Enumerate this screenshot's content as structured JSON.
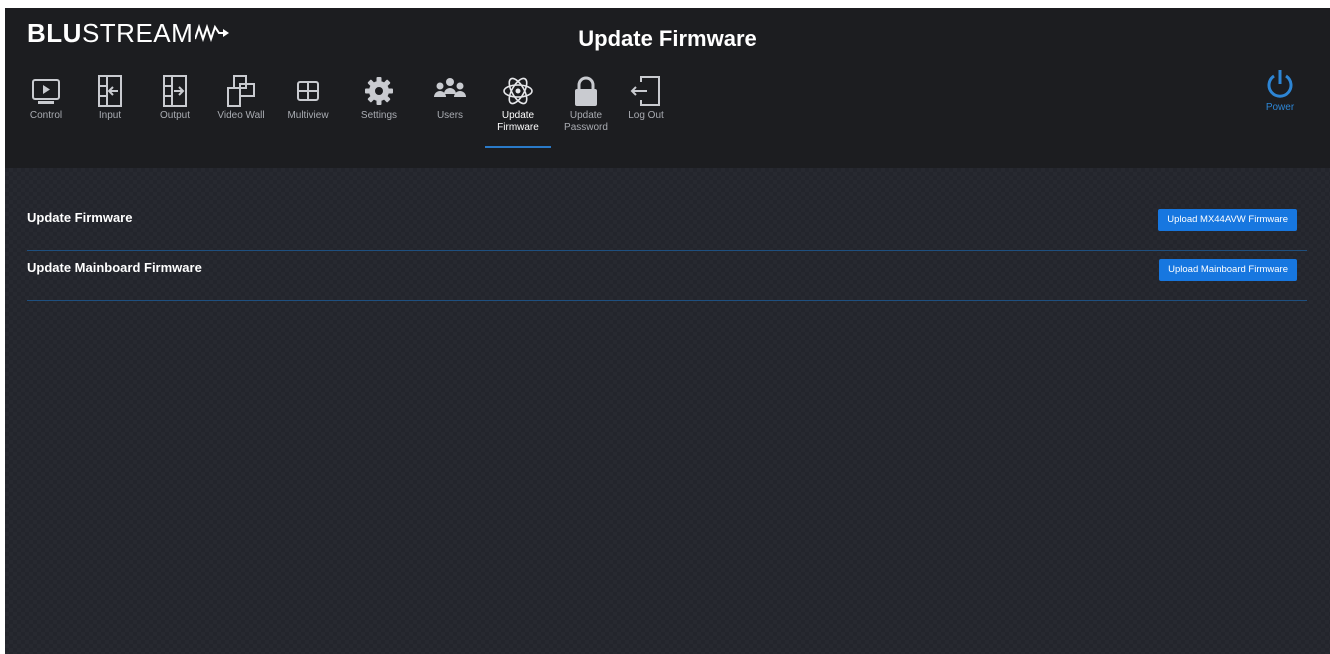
{
  "app": {
    "brand_bold": "BLU",
    "brand_light": "STREAM",
    "page_title": "Update Firmware"
  },
  "nav": {
    "items": [
      {
        "label": "Control",
        "icon": "monitor-play-icon"
      },
      {
        "label": "Input",
        "icon": "input-arrow-icon"
      },
      {
        "label": "Output",
        "icon": "output-arrow-icon"
      },
      {
        "label": "Video Wall",
        "icon": "video-wall-icon"
      },
      {
        "label": "Multiview",
        "icon": "multiview-grid-icon"
      },
      {
        "label": "Settings",
        "icon": "gear-icon"
      },
      {
        "label": "Users",
        "icon": "users-icon"
      },
      {
        "label": "Update Firmware",
        "icon": "atom-icon",
        "active": true
      },
      {
        "label": "Update Password",
        "icon": "lock-icon"
      },
      {
        "label": "Log Out",
        "icon": "logout-icon"
      }
    ],
    "power_label": "Power"
  },
  "main": {
    "rows": [
      {
        "label": "Update Firmware",
        "button": "Upload MX44AVW Firmware"
      },
      {
        "label": "Update Mainboard Firmware",
        "button": "Upload Mainboard Firmware"
      }
    ]
  },
  "colors": {
    "accent": "#1777e0",
    "header_bg": "#1c1d20",
    "body_bg": "#23252c",
    "divider": "#1f4f7e",
    "power": "#2d85d4"
  }
}
